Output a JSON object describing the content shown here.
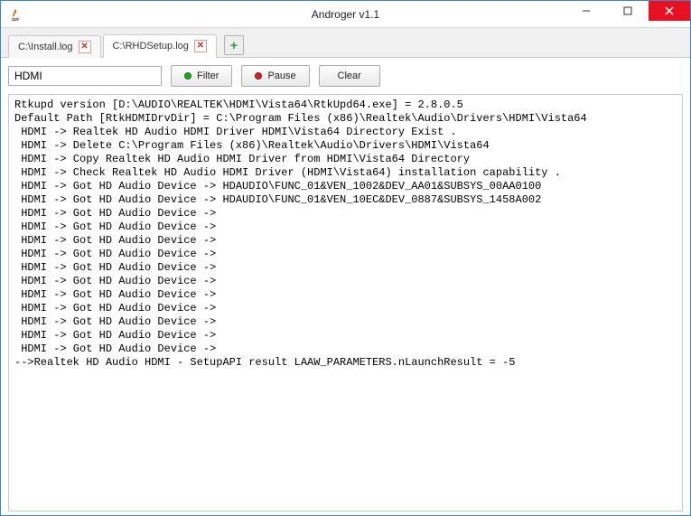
{
  "window": {
    "title": "Androger v1.1"
  },
  "tabs": [
    {
      "label": "C:\\Install.log",
      "active": false
    },
    {
      "label": "C:\\RHDSetup.log",
      "active": true
    }
  ],
  "toolbar": {
    "search_value": "HDMI",
    "filter_label": "Filter",
    "pause_label": "Pause",
    "clear_label": "Clear"
  },
  "log_lines": [
    "Rtkupd version [D:\\AUDIO\\REALTEK\\HDMI\\Vista64\\RtkUpd64.exe] = 2.8.0.5",
    "Default Path [RtkHDMIDrvDir] = C:\\Program Files (x86)\\Realtek\\Audio\\Drivers\\HDMI\\Vista64",
    " HDMI -> Realtek HD Audio HDMI Driver HDMI\\Vista64 Directory Exist .",
    " HDMI -> Delete C:\\Program Files (x86)\\Realtek\\Audio\\Drivers\\HDMI\\Vista64",
    " HDMI -> Copy Realtek HD Audio HDMI Driver from HDMI\\Vista64 Directory",
    " HDMI -> Check Realtek HD Audio HDMI Driver (HDMI\\Vista64) installation capability .",
    " HDMI -> Got HD Audio Device -> HDAUDIO\\FUNC_01&VEN_1002&DEV_AA01&SUBSYS_00AA0100",
    " HDMI -> Got HD Audio Device -> HDAUDIO\\FUNC_01&VEN_10EC&DEV_0887&SUBSYS_1458A002",
    " HDMI -> Got HD Audio Device -> ",
    " HDMI -> Got HD Audio Device -> ",
    " HDMI -> Got HD Audio Device -> ",
    " HDMI -> Got HD Audio Device -> ",
    " HDMI -> Got HD Audio Device -> ",
    " HDMI -> Got HD Audio Device -> ",
    " HDMI -> Got HD Audio Device -> ",
    " HDMI -> Got HD Audio Device -> ",
    " HDMI -> Got HD Audio Device -> ",
    " HDMI -> Got HD Audio Device -> ",
    " HDMI -> Got HD Audio Device -> ",
    "-->Realtek HD Audio HDMI - SetupAPI result LAAW_PARAMETERS.nLaunchResult = -5"
  ]
}
